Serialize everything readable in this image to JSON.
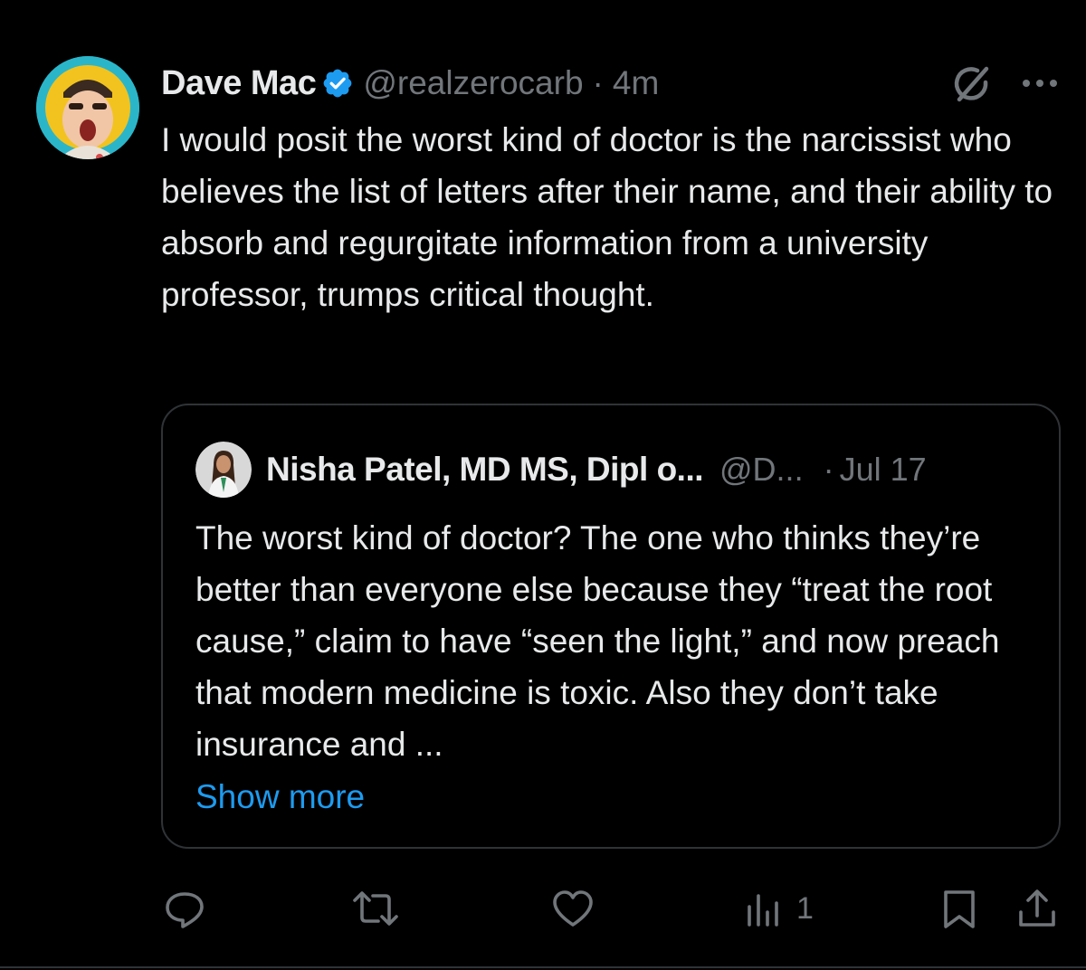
{
  "tweet": {
    "display_name": "Dave Mac",
    "handle": "@realzerocarb",
    "separator": "·",
    "time": "4m",
    "text": "I would posit the worst kind of doctor is the narcissist who believes the list of letters after their name, and their ability to absorb and regurgitate information from a university professor, trumps critical thought.",
    "avatar_icon": "cartoon-face-avatar",
    "verified_icon": "verified-badge-icon",
    "grok_icon": "grok-icon",
    "more_icon": "more-icon"
  },
  "quote": {
    "display_name": "Nisha Patel, MD MS, Dipl o...",
    "handle": "@D...",
    "separator": "·",
    "time": "Jul 17",
    "text": "The worst kind of doctor? The one who thinks they’re better than everyone else because they “treat the root cause,” claim to have “seen the light,” and now preach that modern medicine is toxic. Also they don’t take insurance and ...",
    "show_more": "Show more"
  },
  "actions": {
    "reply_icon": "reply-icon",
    "retweet_icon": "retweet-icon",
    "like_icon": "like-icon",
    "views_icon": "views-icon",
    "views_count": "1",
    "bookmark_icon": "bookmark-icon",
    "share_icon": "share-icon"
  },
  "colors": {
    "background": "#000000",
    "text_primary": "#e7e9ea",
    "text_secondary": "#71767b",
    "accent": "#1d9bf0",
    "border": "#2f3336"
  }
}
